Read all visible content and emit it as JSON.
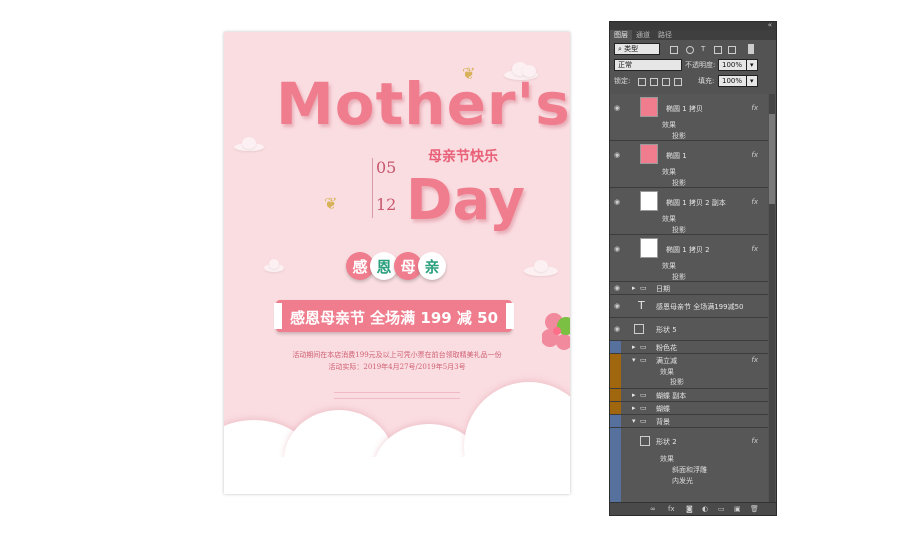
{
  "poster": {
    "title_main": "Mother's",
    "title_cn": "母亲节快乐",
    "title_day": "Day",
    "date_month": "05",
    "date_day": "12",
    "circles": [
      "感",
      "恩",
      "母",
      "亲"
    ],
    "banner": "感恩母亲节  全场满 199 减 50",
    "info_line1": "活动期间在本店消费199元及以上可凭小票在前台领取精美礼品一份",
    "info_line2": "活动实际：2019年4月27号/2019年5月3号"
  },
  "panel": {
    "tabs": [
      "图层",
      "通道",
      "路径"
    ],
    "filter_kind": "类型",
    "blend_mode": "正常",
    "opacity_label": "不透明度:",
    "opacity_value": "100%",
    "lock_label": "锁定:",
    "fill_label": "填充:",
    "fill_value": "100%",
    "layers": [
      {
        "name": "椭圆 1 拷贝",
        "effects": "效果",
        "effect1": "投影"
      },
      {
        "name": "椭圆 1",
        "effects": "效果",
        "effect1": "投影"
      },
      {
        "name": "椭圆 1 拷贝 2 副本",
        "effects": "效果",
        "effect1": "投影"
      },
      {
        "name": "椭圆 1 拷贝 2",
        "effects": "效果",
        "effect1": "投影"
      },
      {
        "name": "日期"
      },
      {
        "name": "感恩母亲节 全场满199减50"
      },
      {
        "name": "形状 5"
      },
      {
        "name": "粉色花"
      },
      {
        "name": "满立减",
        "effects": "效果",
        "effect1": "投影"
      },
      {
        "name": "蝴蝶 副本"
      },
      {
        "name": "蝴蝶"
      },
      {
        "name": "背景"
      },
      {
        "name": "形状 2",
        "effects": "效果",
        "effect1": "斜面和浮雕",
        "effect2": "内发光"
      }
    ],
    "fx_label": "fx",
    "eye_icon": "eye-icon",
    "folder_icon": "folder-icon",
    "colors": {
      "orange_band": "#a0670f",
      "blue_band": "#57719f",
      "poster_bg": "#fadde1",
      "accent": "#ef7d8d"
    }
  }
}
